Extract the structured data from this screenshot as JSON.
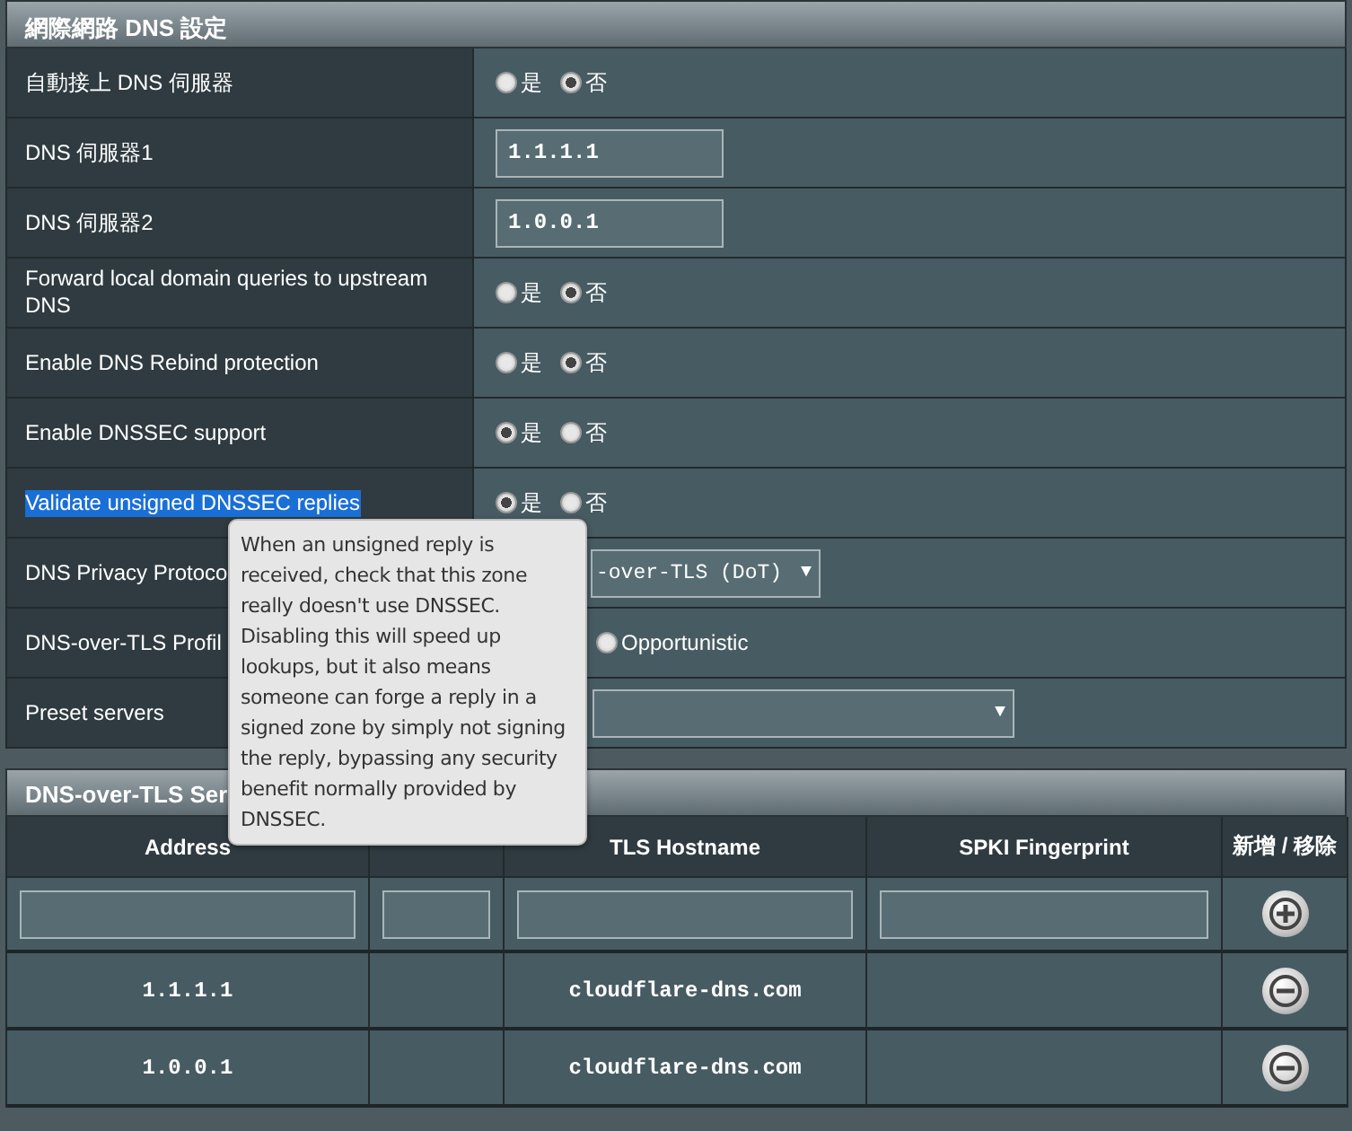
{
  "section_title": "網際網路 DNS 設定",
  "settings": [
    {
      "label": "自動接上 DNS 伺服器",
      "highlighted": false,
      "kind": "radio",
      "options": [
        {
          "label": "是",
          "selected": false
        },
        {
          "label": "否",
          "selected": true
        }
      ]
    },
    {
      "label": "DNS 伺服器1",
      "highlighted": false,
      "kind": "text",
      "value": "1.1.1.1"
    },
    {
      "label": "DNS 伺服器2",
      "highlighted": false,
      "kind": "text",
      "value": "1.0.0.1"
    },
    {
      "label": "Forward local domain queries to upstream DNS",
      "highlighted": false,
      "kind": "radio",
      "options": [
        {
          "label": "是",
          "selected": false
        },
        {
          "label": "否",
          "selected": true
        }
      ]
    },
    {
      "label": "Enable DNS Rebind protection",
      "highlighted": false,
      "kind": "radio",
      "options": [
        {
          "label": "是",
          "selected": false
        },
        {
          "label": "否",
          "selected": true
        }
      ]
    },
    {
      "label": "Enable DNSSEC support",
      "highlighted": false,
      "kind": "radio",
      "options": [
        {
          "label": "是",
          "selected": true
        },
        {
          "label": "否",
          "selected": false
        }
      ]
    },
    {
      "label": "Validate unsigned DNSSEC replies",
      "highlighted": true,
      "kind": "radio",
      "options": [
        {
          "label": "是",
          "selected": true
        },
        {
          "label": "否",
          "selected": false
        }
      ]
    },
    {
      "label": "DNS Privacy Protoco",
      "highlighted": false,
      "kind": "select",
      "value": "-over-TLS (DoT)",
      "caret": "▼"
    },
    {
      "label": "DNS-over-TLS Profil",
      "highlighted": false,
      "kind": "radio",
      "options": [
        {
          "label": "Opportunistic",
          "selected": false
        }
      ]
    },
    {
      "label": "Preset servers",
      "highlighted": false,
      "kind": "select",
      "caret": "▼"
    }
  ],
  "tooltip": "When an unsigned reply is received, check that this zone really doesn't use DNSSEC. Disabling this will speed up lookups, but it also means someone can forge a reply in a signed zone by simply not signing the reply, bypassing any security benefit normally provided by DNSSEC.",
  "server_list": {
    "title": "DNS-over-TLS Ser",
    "columns": [
      "Address",
      "",
      "TLS Hostname",
      "SPKI Fingerprint",
      "新增 / 移除"
    ],
    "rows": [
      {
        "address": "1.1.1.1",
        "tls_hostname": "cloudflare-dns.com"
      },
      {
        "address": "1.0.0.1",
        "tls_hostname": "cloudflare-dns.com"
      }
    ]
  }
}
